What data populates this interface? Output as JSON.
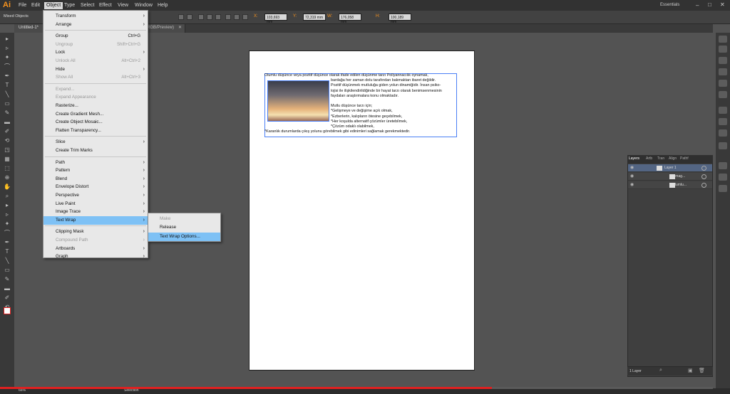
{
  "app": {
    "logo": "Ai",
    "workspace": "Essentials"
  },
  "menubar": {
    "items": [
      "File",
      "Edit",
      "Object",
      "Type",
      "Select",
      "Effect",
      "View",
      "Window",
      "Help"
    ],
    "active": "Object"
  },
  "control": {
    "left_label": "Mixed Objects",
    "fields": [
      {
        "label": "X:",
        "value": "103,693 mm"
      },
      {
        "label": "Y:",
        "value": "72,319 mm"
      },
      {
        "label": "W:",
        "value": "176,058 mm"
      },
      {
        "label": "H:",
        "value": "100,189 mm"
      }
    ]
  },
  "doc_tab": {
    "title": "Untitled-1*",
    "suffix": "RGB/Preview)"
  },
  "object_menu": {
    "rows": [
      {
        "label": "Transform",
        "arrow": true
      },
      {
        "label": "Arrange",
        "arrow": true
      },
      {
        "sep": true
      },
      {
        "label": "Group",
        "shortcut": "Ctrl+G"
      },
      {
        "label": "Ungroup",
        "shortcut": "Shift+Ctrl+G",
        "disabled": true
      },
      {
        "label": "Lock",
        "arrow": true
      },
      {
        "label": "Unlock All",
        "shortcut": "Alt+Ctrl+2",
        "disabled": true
      },
      {
        "label": "Hide",
        "arrow": true
      },
      {
        "label": "Show All",
        "shortcut": "Alt+Ctrl+3",
        "disabled": true
      },
      {
        "sep": true
      },
      {
        "label": "Expand...",
        "disabled": true
      },
      {
        "label": "Expand Appearance",
        "disabled": true
      },
      {
        "label": "Rasterize..."
      },
      {
        "label": "Create Gradient Mesh..."
      },
      {
        "label": "Create Object Mosaic..."
      },
      {
        "label": "Flatten Transparency..."
      },
      {
        "sep": true
      },
      {
        "label": "Slice",
        "arrow": true
      },
      {
        "label": "Create Trim Marks"
      },
      {
        "sep": true
      },
      {
        "label": "Path",
        "arrow": true
      },
      {
        "label": "Pattern",
        "arrow": true
      },
      {
        "label": "Blend",
        "arrow": true
      },
      {
        "label": "Envelope Distort",
        "arrow": true
      },
      {
        "label": "Perspective",
        "arrow": true
      },
      {
        "label": "Live Paint",
        "arrow": true
      },
      {
        "label": "Image Trace",
        "arrow": true
      },
      {
        "label": "Text Wrap",
        "arrow": true,
        "highlight": true
      },
      {
        "sep": true
      },
      {
        "label": "Clipping Mask",
        "arrow": true
      },
      {
        "label": "Compound Path",
        "arrow": true,
        "disabled": true
      },
      {
        "label": "Artboards",
        "arrow": true
      },
      {
        "label": "Graph",
        "arrow": true
      }
    ]
  },
  "text_wrap_submenu": {
    "rows": [
      {
        "label": "Make",
        "disabled": true
      },
      {
        "label": "Release"
      },
      {
        "label": "Text Wrap Options...",
        "highlight": true
      }
    ]
  },
  "document_text": [
    "Olumlu düşünce veya pozitif düşünce olarak ifade edilen düşünme tarzı Pollyannacılık oynamak,",
    "bardağa her zaman dolu tarafından bakmaktan ibaret değildir.",
    "Pozitif düşünmek mutluluğa giden yolun dinamiğidir. İnsan psiko-",
    "lojisi ile ilişkilendirildiğinde bir hayat tarzı olarak benimsenmesinin",
    "faydaları araştırmalara konu olmaktadır.",
    "",
    "Mutlu düşünce tarzı için;",
    "*Gelişmeye ve değişime açık olmak,",
    "*Ezberlerin, kalıpların ötesine geçebilmek,",
    "*Her koşulda alternatif çözümler üretebilmek,",
    "*Çözüm odaklı olabilmek,",
    "*Karanlık durumlarda çıkış yolunu görebilmek gibi edinimleri sağlamak gerekmektedir."
  ],
  "layers_panel": {
    "tabs": [
      "Layers",
      "Artb",
      "Tran",
      "Align",
      "Pathf"
    ],
    "rows": [
      {
        "name": "Layer 1",
        "selected": true
      },
      {
        "name": "<Imag..."
      },
      {
        "name": "Olumlu..."
      }
    ],
    "footer": "1 Layer"
  },
  "status": {
    "zoom": "66%",
    "tool": "Selection",
    "progress_fraction": 0.69
  },
  "colors": {
    "accent": "#f7931e",
    "highlight": "#7ec1f5",
    "selection": "#4a7ff5",
    "progress": "#e02020"
  }
}
